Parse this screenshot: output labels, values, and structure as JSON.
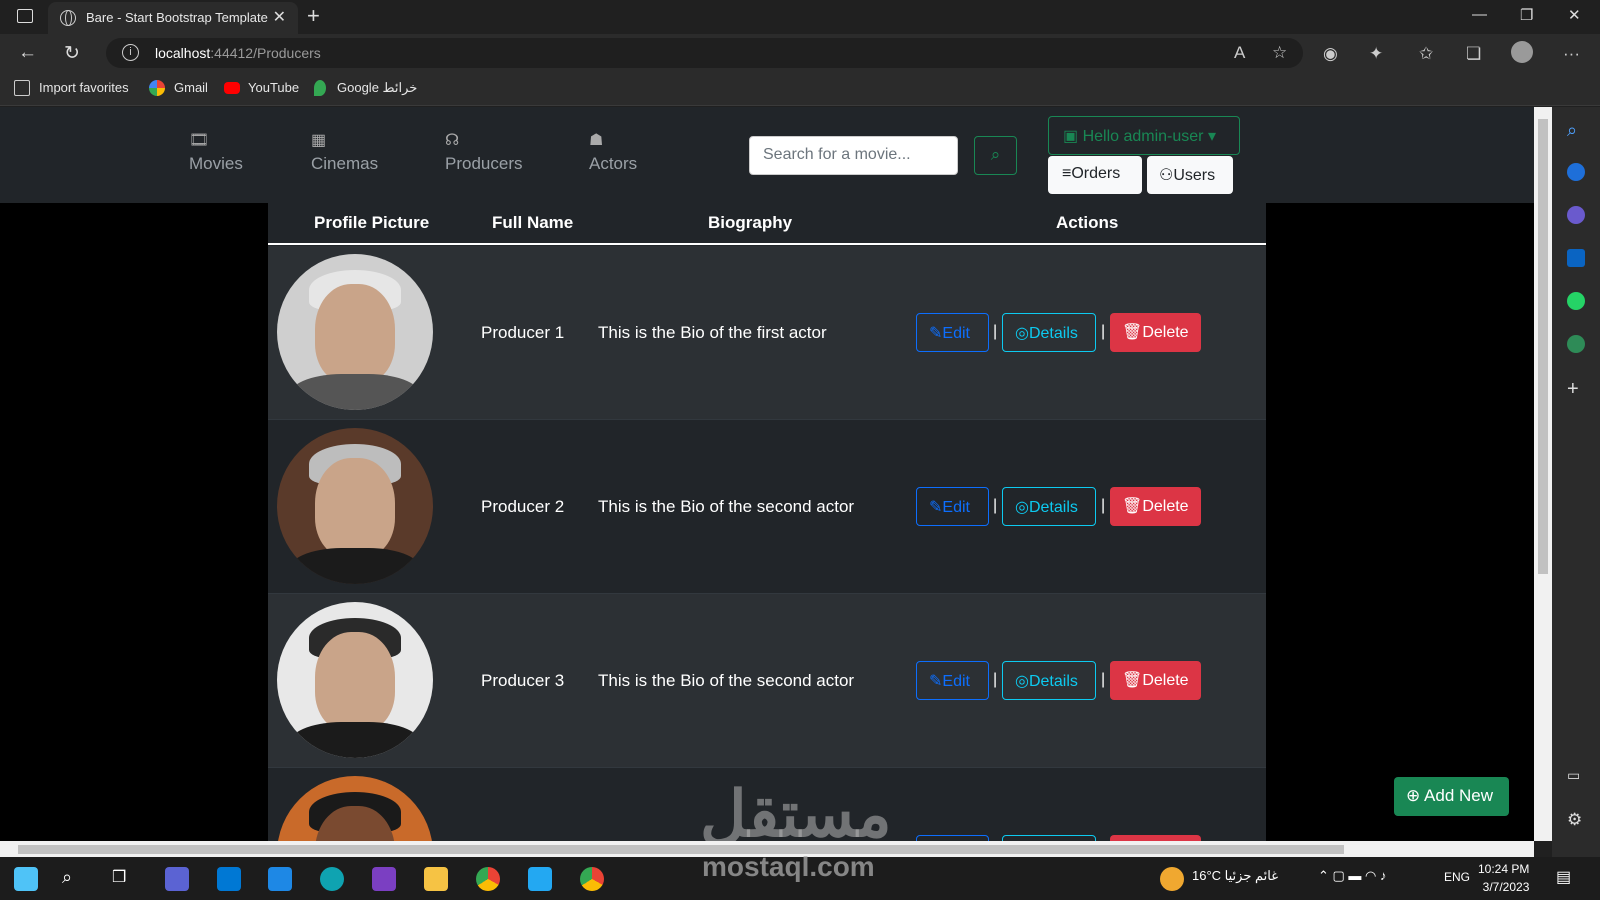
{
  "browser": {
    "tab_title": "Bare - Start Bootstrap Template",
    "url_host": "localhost",
    "url_path": ":44412/Producers",
    "favorites": [
      {
        "label": "Import favorites",
        "icon": "import-icon"
      },
      {
        "label": "Gmail",
        "icon": "google-icon"
      },
      {
        "label": "YouTube",
        "icon": "youtube-icon"
      },
      {
        "label": "Google خرائط",
        "icon": "maps-icon"
      }
    ]
  },
  "nav": {
    "items": [
      {
        "label": "Movies",
        "icon": "film-icon"
      },
      {
        "label": "Cinemas",
        "icon": "cinema-icon"
      },
      {
        "label": "Producers",
        "icon": "headset-icon"
      },
      {
        "label": "Actors",
        "icon": "person-badge-icon"
      }
    ],
    "search_placeholder": "Search for a movie...",
    "user_menu": "Hello admin-user",
    "orders_label": "Orders",
    "users_label": "Users"
  },
  "table": {
    "headers": [
      "Profile Picture",
      "Full Name",
      "Biography",
      "Actions"
    ],
    "rows": [
      {
        "name": "Producer 1",
        "bio": "This is the Bio of the first actor"
      },
      {
        "name": "Producer 2",
        "bio": "This is the Bio of the second actor"
      },
      {
        "name": "Producer 3",
        "bio": "This is the Bio of the second actor"
      }
    ],
    "edit_label": "Edit",
    "details_label": "Details",
    "delete_label": "Delete",
    "separator": "|"
  },
  "add_new_label": "Add New",
  "watermark": {
    "arabic": "مستقل",
    "latin": "mostaql.com"
  },
  "taskbar": {
    "weather": "16°C  غائم جزئيا",
    "lang": "ENG",
    "time": "10:24 PM",
    "date": "3/7/2023"
  },
  "colors": {
    "success": "#198754",
    "primary": "#0d6efd",
    "info": "#0dcaf0",
    "danger": "#dc3545",
    "navbar": "#212529"
  }
}
